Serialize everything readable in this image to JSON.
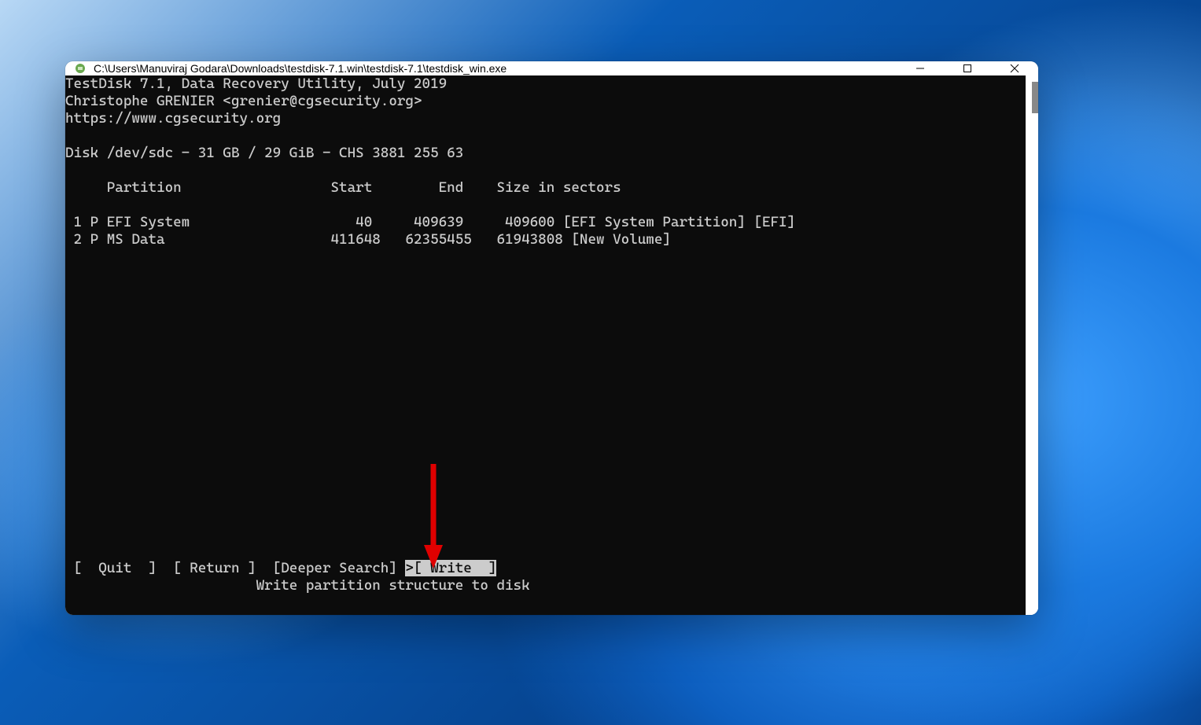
{
  "window": {
    "title": "C:\\Users\\Manuviraj Godara\\Downloads\\testdisk-7.1.win\\testdisk-7.1\\testdisk_win.exe"
  },
  "terminal": {
    "header": {
      "line1": "TestDisk 7.1, Data Recovery Utility, July 2019",
      "line2": "Christophe GRENIER <grenier@cgsecurity.org>",
      "line3": "https://www.cgsecurity.org"
    },
    "disk_line": "Disk /dev/sdc - 31 GB / 29 GiB - CHS 3881 255 63",
    "columns_line": "     Partition                  Start        End    Size in sectors",
    "partition_lines": [
      " 1 P EFI System                    40     409639     409600 [EFI System Partition] [EFI]",
      " 2 P MS Data                    411648   62355455   61943808 [New Volume]"
    ],
    "menu": {
      "quit": "[  Quit  ]",
      "return": "[ Return ]",
      "deeper": "[Deeper Search]",
      "write_prefix": ">",
      "write": "[ Write  ]"
    },
    "hint": "                       Write partition structure to disk"
  }
}
